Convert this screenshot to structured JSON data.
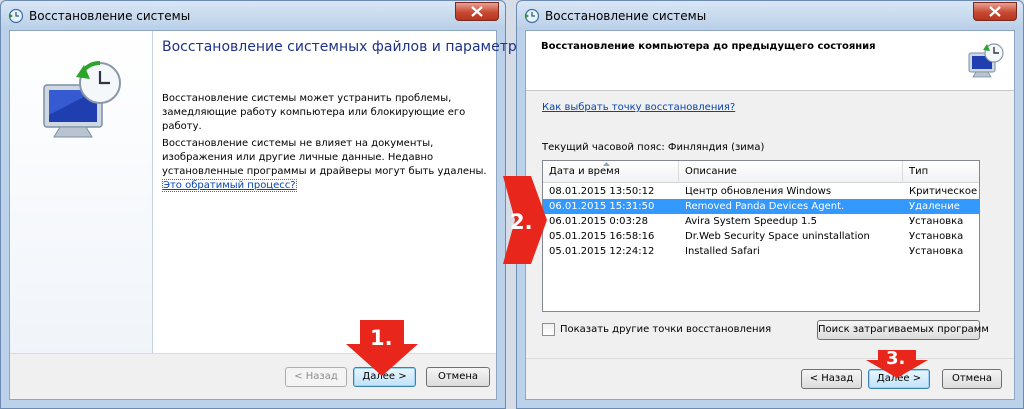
{
  "window1": {
    "title": "Восстановление системы",
    "heading": "Восстановление системных файлов и параметров",
    "paragraph1": "Восстановление системы может устранить проблемы, замедляющие работу компьютера или блокирующие его работу.",
    "paragraph2": "Восстановление системы не влияет на документы, изображения или другие личные данные. Недавно установленные программы и драйверы могут быть удалены.",
    "paragraph2_link": "Это обратимый процесс?",
    "buttons": {
      "back": "< Назад",
      "next": "Далее >",
      "cancel": "Отмена"
    }
  },
  "window2": {
    "title": "Восстановление системы",
    "heading": "Восстановление компьютера до предыдущего состояния",
    "help_link": "Как выбрать точку восстановления?",
    "timezone": "Текущий часовой пояс: Финляндия (зима)",
    "table": {
      "columns": [
        "Дата и время",
        "Описание",
        "Тип"
      ],
      "rows": [
        [
          "08.01.2015 13:50:12",
          "Центр обновления Windows",
          "Критическое о..."
        ],
        [
          "06.01.2015 15:31:50",
          "Removed Panda Devices Agent.",
          "Удаление"
        ],
        [
          "06.01.2015 0:03:28",
          "Avira System Speedup 1.5",
          "Установка"
        ],
        [
          "05.01.2015 16:58:16",
          "Dr.Web Security Space uninstallation",
          "Установка"
        ],
        [
          "05.01.2015 12:24:12",
          "Installed Safari",
          "Установка"
        ]
      ],
      "selected_row": 1
    },
    "show_more_checkbox": "Показать другие точки восстановления",
    "scan_button": "Поиск затрагиваемых программ",
    "buttons": {
      "back": "< Назад",
      "next": "Далее >",
      "cancel": "Отмена"
    }
  },
  "annotations": {
    "step1": "1.",
    "step2": "2.",
    "step3": "3."
  },
  "colors": {
    "annotation_red": "#e8261b",
    "selection_blue": "#3399ff",
    "heading_blue": "#1e3287",
    "link_blue": "#0645ad"
  }
}
